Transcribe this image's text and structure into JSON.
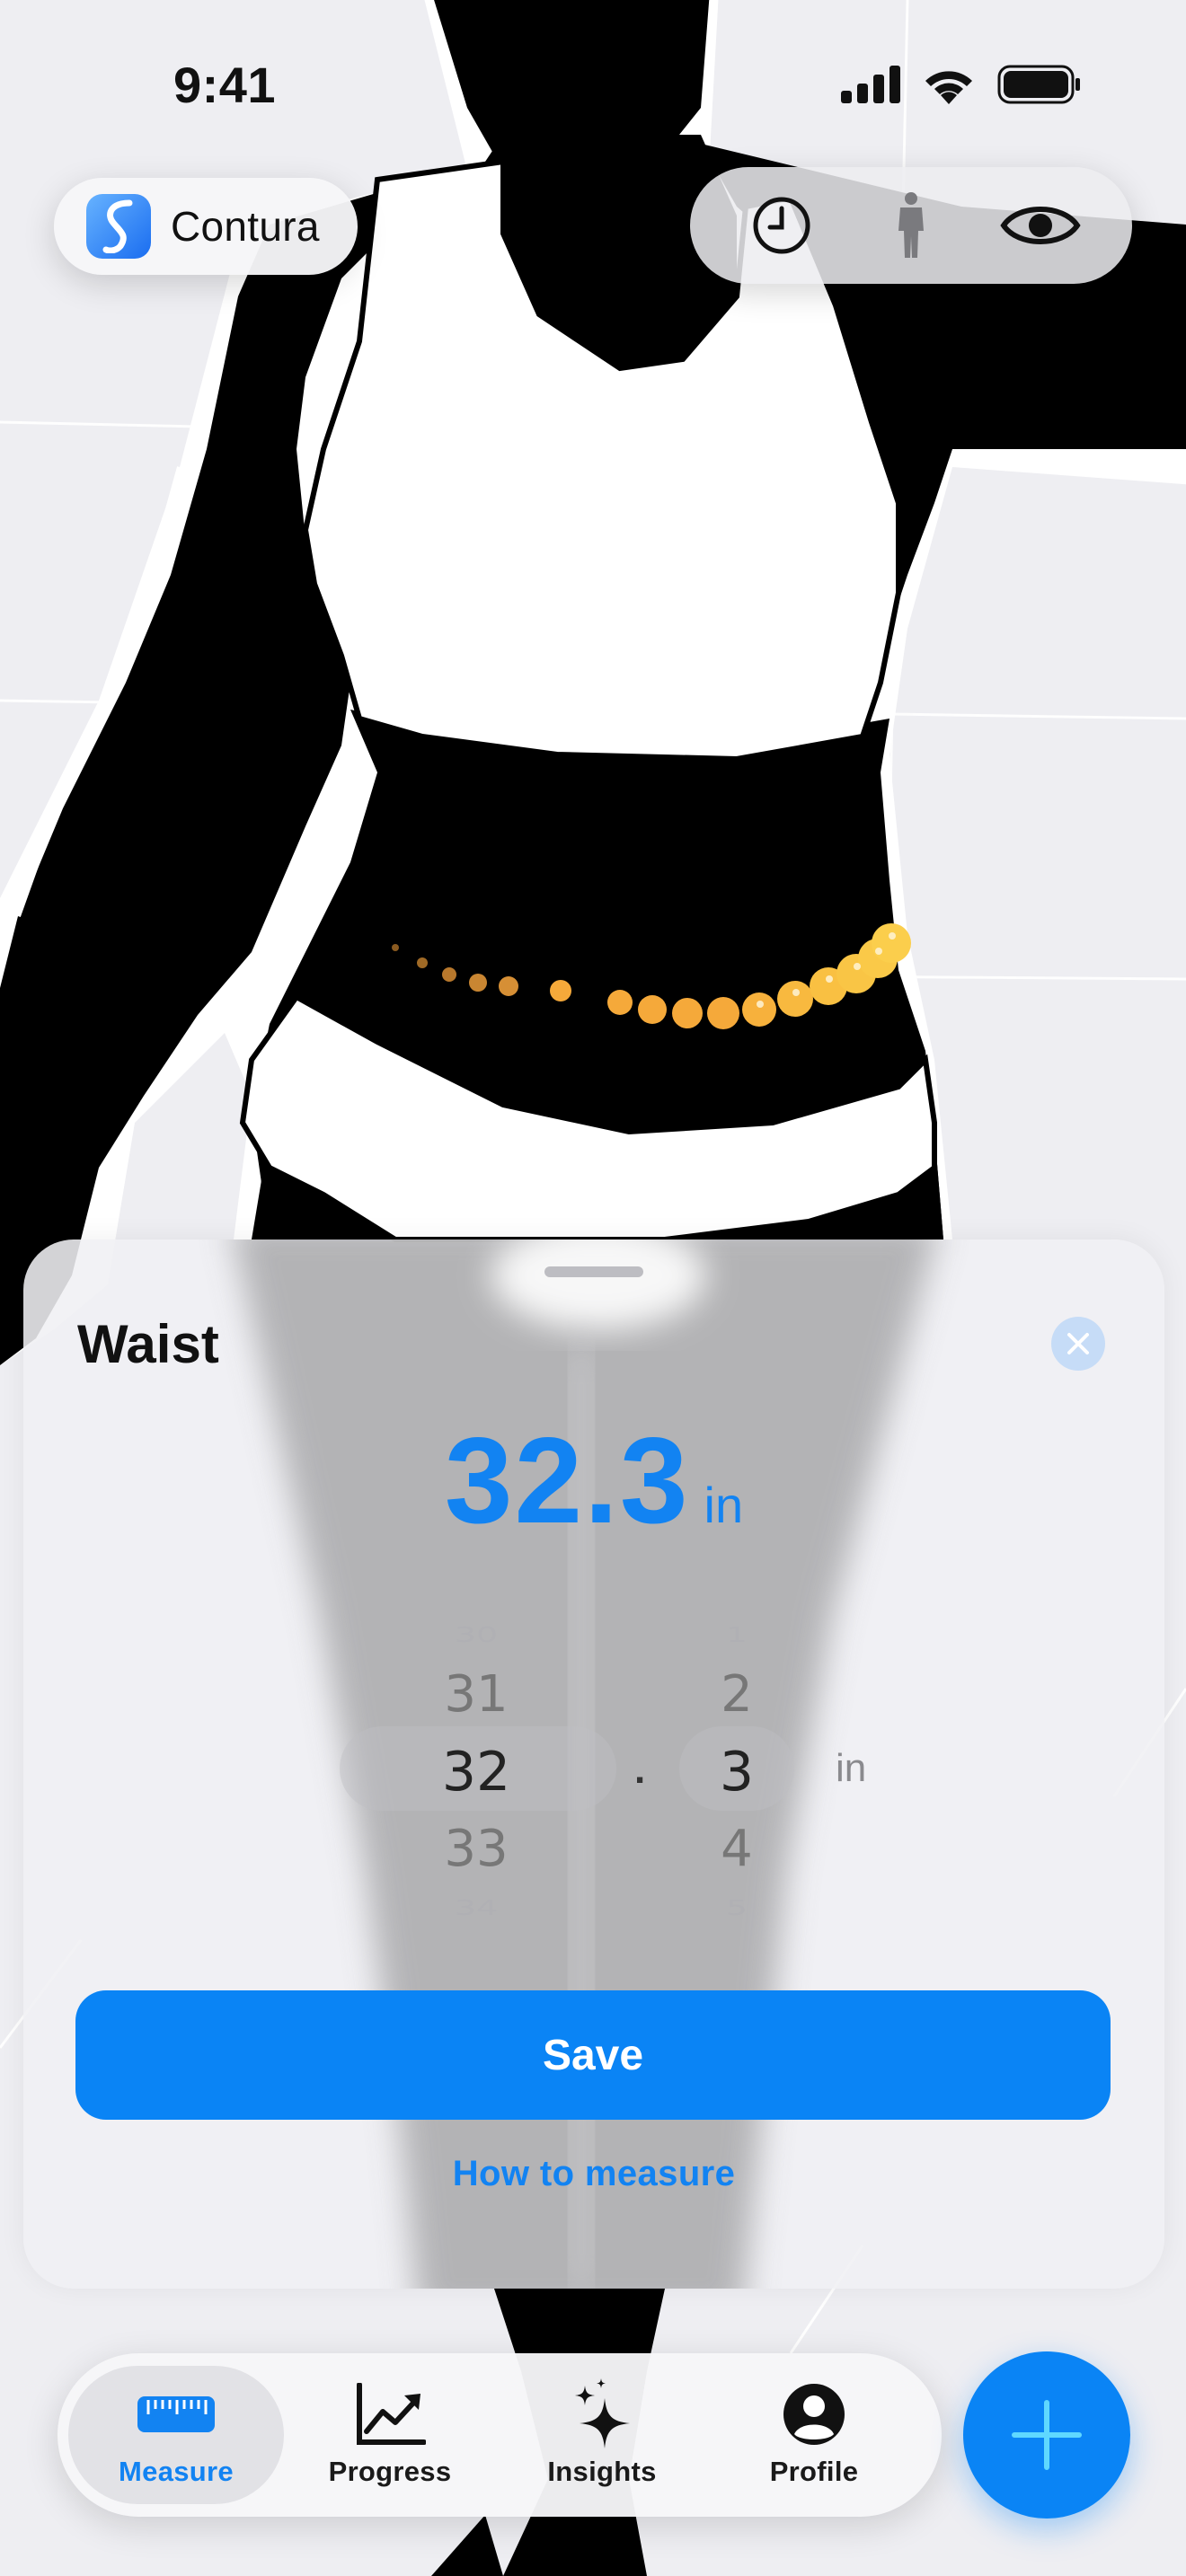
{
  "status_bar": {
    "time": "9:41",
    "signal_icon": "cellular-signal-icon",
    "wifi_icon": "wifi-icon",
    "battery_icon": "battery-icon"
  },
  "header": {
    "app_name": "Contura",
    "app_logo_icon": "contura-logo-icon",
    "view_controls": [
      {
        "icon": "clock-history-icon"
      },
      {
        "icon": "body-figure-icon"
      },
      {
        "icon": "eye-icon"
      }
    ]
  },
  "sheet": {
    "title": "Waist",
    "close_icon": "close-icon",
    "value": "32.3",
    "unit": "in",
    "picker": {
      "whole": {
        "above2": "30",
        "above1": "31",
        "selected": "32",
        "below1": "33",
        "below2": "34"
      },
      "separator": ".",
      "decimal": {
        "above2": "1",
        "above1": "2",
        "selected": "3",
        "below1": "4",
        "below2": "5"
      },
      "unit": "in"
    },
    "save_label": "Save",
    "how_to_label": "How to measure"
  },
  "tabbar": {
    "tabs": [
      {
        "label": "Measure",
        "icon": "ruler-icon",
        "active": true
      },
      {
        "label": "Progress",
        "icon": "chart-line-icon",
        "active": false
      },
      {
        "label": "Insights",
        "icon": "sparkles-icon",
        "active": false
      },
      {
        "label": "Profile",
        "icon": "person-circle-icon",
        "active": false
      }
    ],
    "fab_icon": "plus-icon"
  },
  "colors": {
    "accent": "#0a84f5",
    "measurement_dots": "#f5a93a",
    "background": "#eeeef2"
  }
}
